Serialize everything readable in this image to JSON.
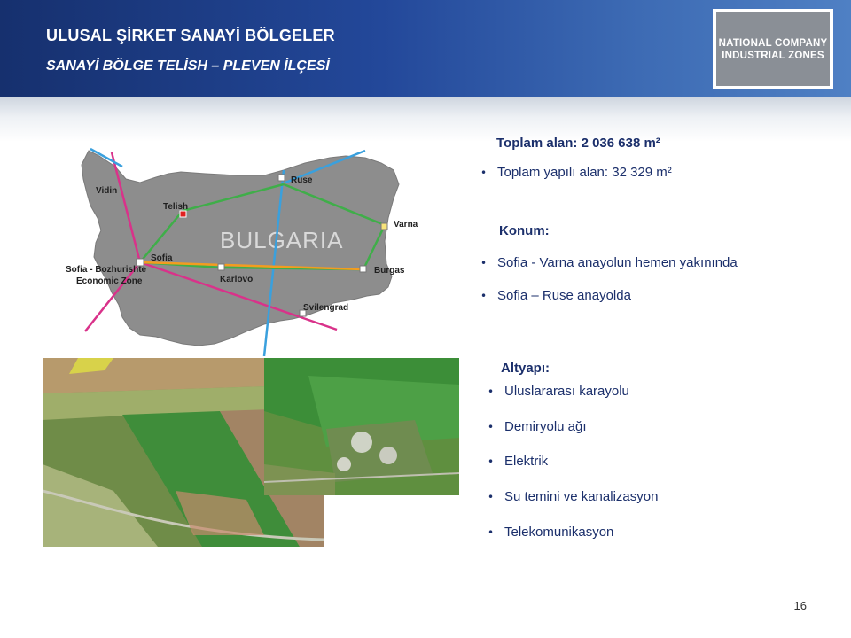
{
  "header": {
    "title": "ULUSAL ŞİRKET SANAYİ BÖLGELER",
    "subtitle": "SANAYİ BÖLGE TELİSH – PLEVEN İLÇESİ",
    "logo_line1": "NATIONAL COMPANY",
    "logo_line2": "INDUSTRIAL ZONES"
  },
  "map": {
    "country": "BULGARIA",
    "cities": {
      "vidin": "Vidin",
      "ruse": "Ruse",
      "telish": "Telish",
      "varna": "Varna",
      "sofia": "Sofia",
      "burgas": "Burgas",
      "karlovo": "Karlovo",
      "svilengrad": "Svilengrad",
      "bozhurishte_1": "Sofia - Bozhurishte",
      "bozhurishte_2": "Economic Zone"
    }
  },
  "info": {
    "total_area": "Toplam alan: 2 036 638 m²",
    "built_area": "Toplam yapılı alan: 32 329 m²",
    "location_heading": "Konum:",
    "location_items": [
      "Sofia - Varna anayolun hemen yakınında",
      "Sofia – Ruse anayolda"
    ],
    "infra_heading": "Altyapı:",
    "infra_items": [
      "Uluslararası karayolu",
      "Demiryolu ağı",
      "Elektrik",
      "Su temini ve kanalizasyon",
      "Telekomunikasyon"
    ]
  },
  "page_number": "16"
}
